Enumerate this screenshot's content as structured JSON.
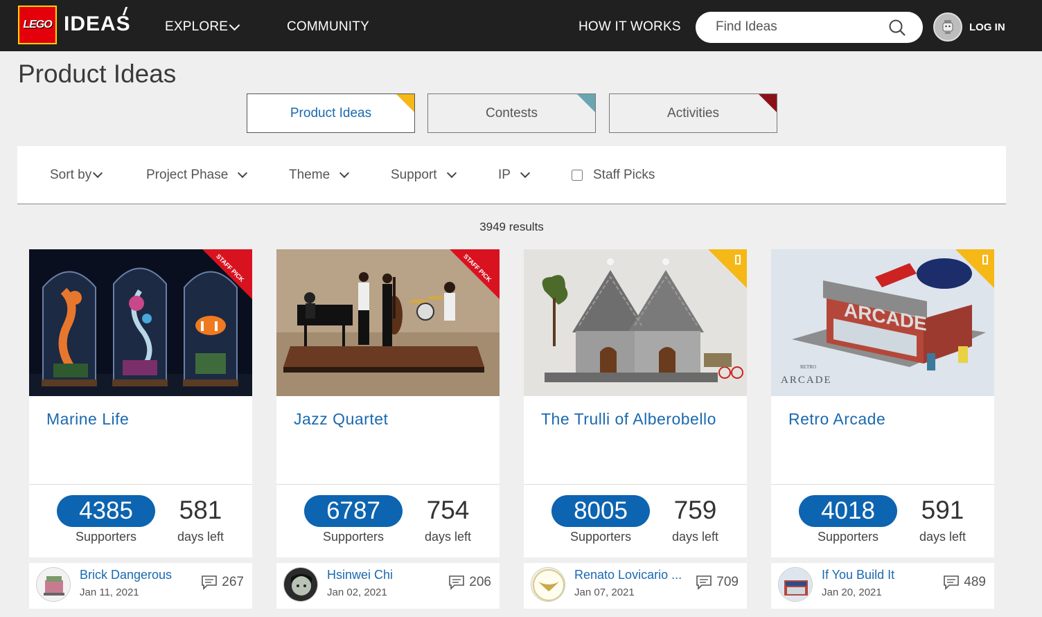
{
  "header": {
    "logo_lego": "LEGO",
    "logo_ideas": "IDEAS",
    "nav": {
      "explore": "EXPLORE",
      "community": "COMMUNITY",
      "how_it_works": "HOW IT WORKS"
    },
    "search": {
      "placeholder": "Find Ideas"
    },
    "login": "LOG IN"
  },
  "page_title": "Product Ideas",
  "tabs": [
    {
      "label": "Product Ideas",
      "corner_color": "#f5b817"
    },
    {
      "label": "Contests",
      "corner_color": "#6aa6b0"
    },
    {
      "label": "Activities",
      "corner_color": "#8b1119"
    }
  ],
  "filters": {
    "sort": "Sort by",
    "phase": "Project Phase",
    "theme": "Theme",
    "support": "Support",
    "ip": "IP",
    "staff_picks": "Staff Picks"
  },
  "results": "3949 results",
  "staff_pick_label": "STAFF PICK",
  "cards": [
    {
      "title": "Marine Life",
      "supporters": "4385",
      "supporters_label": "Supporters",
      "days": "581",
      "days_label": "days left",
      "author": "Brick Dangerous",
      "date": "Jan 11, 2021",
      "comments": "267"
    },
    {
      "title": "Jazz Quartet",
      "supporters": "6787",
      "supporters_label": "Supporters",
      "days": "754",
      "days_label": "days left",
      "author": "Hsinwei Chi",
      "date": "Jan 02, 2021",
      "comments": "206"
    },
    {
      "title": "The Trulli of Alberobello",
      "supporters": "8005",
      "supporters_label": "Supporters",
      "days": "759",
      "days_label": "days left",
      "author": "Renato Lovicario ...",
      "date": "Jan 07, 2021",
      "comments": "709"
    },
    {
      "title": "Retro Arcade",
      "supporters": "4018",
      "supporters_label": "Supporters",
      "days": "591",
      "days_label": "days left",
      "author": "If You Build It",
      "date": "Jan 20, 2021",
      "comments": "489"
    }
  ],
  "image_text": {
    "retro_arcade_caption": "ARCADE",
    "retro_small": "RETRO",
    "arcade_sign": "ARCADE"
  },
  "colors": {
    "accent": "#0d64b0",
    "link": "#1a69b0",
    "staff_pick": "#d9121f",
    "corner_yellow": "#f5b817"
  }
}
